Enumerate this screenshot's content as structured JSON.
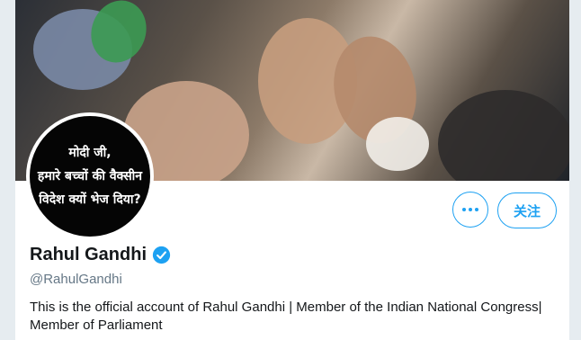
{
  "banner": {
    "icon": "crowd-photo"
  },
  "avatar": {
    "lines": [
      "मोदी जी,",
      "हमारे बच्चों की वैक्सीन",
      "विदेश क्यों भेज दिया?"
    ]
  },
  "actions": {
    "more_icon": "more-icon",
    "follow_label": "关注"
  },
  "profile": {
    "name": "Rahul Gandhi",
    "handle": "@RahulGandhi",
    "bio": "This is the official account of Rahul Gandhi | Member of the Indian National Congress| Member of Parliament"
  },
  "colors": {
    "accent": "#1da1f2",
    "text": "#14171a",
    "muted": "#657786"
  }
}
